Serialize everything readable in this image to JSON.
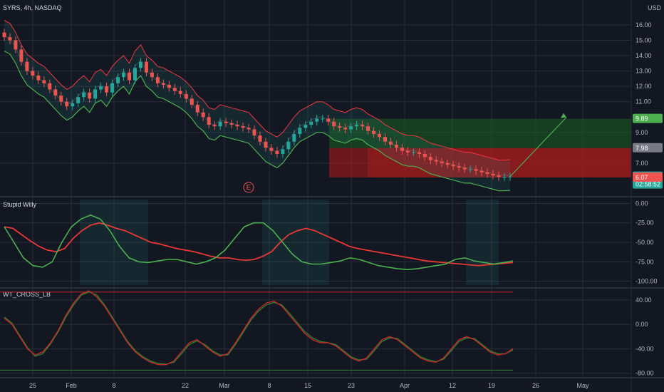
{
  "header": {
    "symbol": "SYRS, 4h, NASDAQ",
    "currency": "USD"
  },
  "colors": {
    "background": "#131722",
    "grid": "#2a2e39",
    "bull": "#26a69a",
    "bear": "#ef5350",
    "bb_upper": "#f23645",
    "bb_lower": "#4caf50",
    "willy_red": "#e53935",
    "willy_green": "#4caf50",
    "willy_raw": "#5b8bb0",
    "wt_red": "#c62828",
    "wt_green": "#2e7d32",
    "wt_volume": "#283593",
    "profit_zone": "#1b5e20",
    "loss_zone": "#b71c1c",
    "target_arrow": "#4caf50"
  },
  "x_axis": {
    "labels": [
      "25",
      "Feb",
      "8",
      "22",
      "Mar",
      "8",
      "15",
      "23",
      "Apr",
      "12",
      "19",
      "26",
      "May"
    ]
  },
  "price_axis": {
    "ticks": [
      "16.00",
      "15.00",
      "14.00",
      "13.00",
      "12.00",
      "11.00",
      "9.00",
      "7.00"
    ],
    "badges": [
      {
        "text": "9.89",
        "color": "#4caf50"
      },
      {
        "text": "7.98",
        "color": "#787b86"
      },
      {
        "text": "6.13",
        "color": "#26a69a"
      },
      {
        "text": "02:58:52",
        "color": "#26a69a"
      },
      {
        "text": "6.07",
        "color": "#ef5350"
      }
    ],
    "earnings_marker": "E"
  },
  "pane_willy": {
    "title": "Stupid Willy",
    "ticks": [
      "0.00",
      "-25.00",
      "-50.00",
      "-75.00",
      "-100.00"
    ]
  },
  "pane_wt": {
    "title": "WT_CROSS_LB",
    "ticks": [
      "40.00",
      "0.00",
      "-40.00",
      "-80.00"
    ]
  },
  "chart_data": {
    "type": "candlestick",
    "title": "SYRS, 4h, NASDAQ",
    "price_range": [
      5.0,
      16.6
    ],
    "close_series": [
      15.2,
      15.0,
      14.4,
      13.6,
      13.0,
      12.7,
      12.4,
      12.2,
      11.8,
      11.4,
      11.0,
      10.7,
      10.9,
      11.3,
      11.6,
      11.2,
      11.8,
      12.0,
      11.6,
      12.2,
      12.6,
      12.9,
      12.4,
      13.2,
      13.6,
      12.9,
      12.6,
      12.2,
      12.1,
      11.9,
      11.7,
      11.5,
      11.2,
      10.8,
      10.3,
      10.0,
      9.5,
      9.4,
      9.7,
      9.6,
      9.5,
      9.4,
      9.3,
      9.2,
      8.8,
      8.4,
      8.0,
      7.8,
      7.6,
      7.9,
      8.4,
      8.9,
      9.3,
      9.5,
      9.7,
      9.9,
      9.9,
      9.7,
      9.4,
      9.3,
      9.2,
      9.4,
      9.5,
      9.4,
      9.1,
      8.9,
      8.7,
      8.4,
      8.2,
      8.0,
      7.8,
      7.7,
      7.7,
      7.6,
      7.4,
      7.2,
      7.1,
      7.0,
      6.9,
      6.8,
      6.7,
      6.6,
      6.6,
      6.5,
      6.4,
      6.3,
      6.2,
      6.1,
      6.1,
      6.13
    ],
    "trade_box": {
      "target": 9.89,
      "entry": 7.98,
      "stop": 6.07,
      "last": 6.13
    },
    "stupid_willy": {
      "range": [
        -105,
        5
      ],
      "red_line": [
        -30,
        -32,
        -40,
        -48,
        -55,
        -60,
        -62,
        -58,
        -45,
        -35,
        -28,
        -25,
        -28,
        -32,
        -35,
        -40,
        -45,
        -50,
        -52,
        -55,
        -58,
        -60,
        -62,
        -65,
        -68,
        -70,
        -70,
        -72,
        -73,
        -72,
        -68,
        -62,
        -50,
        -40,
        -35,
        -32,
        -35,
        -40,
        -45,
        -50,
        -55,
        -58,
        -60,
        -62,
        -64,
        -66,
        -68,
        -70,
        -72,
        -74,
        -75,
        -76,
        -77,
        -78,
        -79,
        -80,
        -79,
        -78,
        -77,
        -76
      ],
      "green_line": [
        -30,
        -50,
        -70,
        -80,
        -82,
        -75,
        -50,
        -30,
        -20,
        -15,
        -20,
        -35,
        -55,
        -70,
        -75,
        -76,
        -74,
        -72,
        -72,
        -75,
        -78,
        -75,
        -70,
        -60,
        -45,
        -30,
        -25,
        -25,
        -35,
        -50,
        -65,
        -75,
        -78,
        -78,
        -76,
        -74,
        -70,
        -72,
        -76,
        -80,
        -82,
        -84,
        -85,
        -84,
        -82,
        -80,
        -78,
        -72,
        -70,
        -74,
        -76,
        -78,
        -76,
        -74
      ]
    },
    "wt_cross": {
      "range": [
        -85,
        55
      ],
      "red_line": [
        10,
        0,
        -20,
        -40,
        -50,
        -45,
        -30,
        -10,
        15,
        35,
        50,
        55,
        45,
        30,
        10,
        -10,
        -30,
        -45,
        -55,
        -62,
        -66,
        -66,
        -60,
        -45,
        -30,
        -25,
        -35,
        -45,
        -52,
        -48,
        -30,
        -10,
        10,
        25,
        35,
        38,
        30,
        15,
        0,
        -15,
        -25,
        -30,
        -30,
        -35,
        -45,
        -55,
        -60,
        -55,
        -40,
        -25,
        -20,
        -25,
        -35,
        -45,
        -55,
        -60,
        -62,
        -55,
        -40,
        -25,
        -20,
        -25,
        -35,
        -45,
        -50,
        -48,
        -40
      ],
      "green_line": [
        12,
        2,
        -18,
        -38,
        -52,
        -48,
        -32,
        -12,
        12,
        32,
        48,
        53,
        48,
        32,
        12,
        -8,
        -28,
        -43,
        -53,
        -60,
        -64,
        -65,
        -62,
        -48,
        -33,
        -27,
        -33,
        -43,
        -50,
        -50,
        -33,
        -13,
        7,
        22,
        32,
        36,
        32,
        18,
        3,
        -12,
        -22,
        -28,
        -30,
        -33,
        -43,
        -53,
        -58,
        -57,
        -43,
        -28,
        -22,
        -23,
        -33,
        -43,
        -53,
        -58,
        -61,
        -57,
        -43,
        -28,
        -22,
        -23,
        -33,
        -43,
        -48,
        -48,
        -42
      ]
    }
  }
}
